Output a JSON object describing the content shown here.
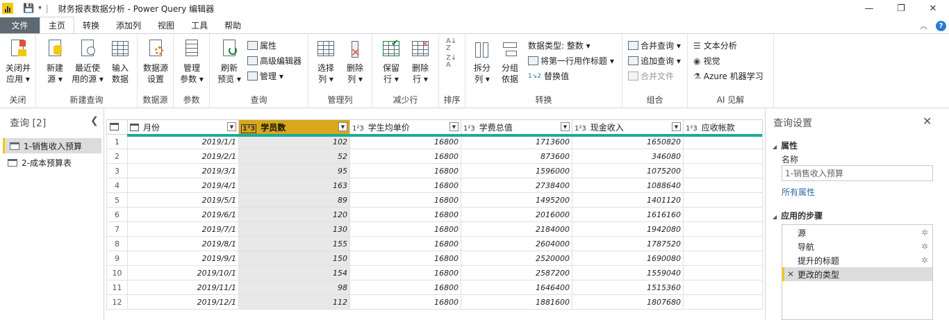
{
  "titlebar": {
    "title": "财务报表数据分析 - Power Query 编辑器"
  },
  "tabs": {
    "file": "文件",
    "items": [
      "主页",
      "转换",
      "添加列",
      "视图",
      "工具",
      "帮助"
    ],
    "active": "主页"
  },
  "ribbon": {
    "close": {
      "btn": "关闭并应用",
      "btn_l1": "关闭并",
      "btn_l2": "应用 ▾",
      "label": "关闭"
    },
    "newquery": {
      "new_l1": "新建",
      "new_l2": "源 ▾",
      "recent_l1": "最近使",
      "recent_l2": "用的源 ▾",
      "enter_l1": "输入",
      "enter_l2": "数据",
      "label": "新建查询"
    },
    "datasource": {
      "btn_l1": "数据源",
      "btn_l2": "设置",
      "label": "数据源"
    },
    "params": {
      "btn_l1": "管理",
      "btn_l2": "参数 ▾",
      "label": "参数"
    },
    "query": {
      "refresh_l1": "刷新",
      "refresh_l2": "预览 ▾",
      "properties": "属性",
      "advanced": "高级编辑器",
      "manage": "管理 ▾",
      "label": "查询"
    },
    "managecols": {
      "choose_l1": "选择",
      "choose_l2": "列 ▾",
      "remove_l1": "删除",
      "remove_l2": "列 ▾",
      "label": "管理列"
    },
    "reducerows": {
      "keep_l1": "保留",
      "keep_l2": "行 ▾",
      "remove_l1": "删除",
      "remove_l2": "行 ▾",
      "label": "减少行"
    },
    "sort": {
      "label": "排序"
    },
    "transform": {
      "split_l1": "拆分",
      "split_l2": "列 ▾",
      "group_l1": "分组",
      "group_l2": "依据",
      "datatype": "数据类型: 整数 ▾",
      "firstrow": "将第一行用作标题 ▾",
      "replace": "替换值",
      "label": "转换"
    },
    "combine": {
      "merge": "合并查询 ▾",
      "append": "追加查询 ▾",
      "files": "合并文件",
      "label": "组合"
    },
    "ai": {
      "text": "文本分析",
      "vision": "视觉",
      "azure": "Azure 机器学习",
      "label": "AI 见解"
    }
  },
  "queries": {
    "header": "查询 [2]",
    "items": [
      "1-销售收入预算",
      "2-成本预算表"
    ],
    "selected": 0
  },
  "grid": {
    "columns": [
      {
        "type": "date",
        "name": "月份"
      },
      {
        "type": "123",
        "name": "学员数",
        "selected": true
      },
      {
        "type": "123",
        "name": "学生均单价"
      },
      {
        "type": "123",
        "name": "学费总值"
      },
      {
        "type": "123",
        "name": "现金收入"
      },
      {
        "type": "123",
        "name": "应收帐款"
      }
    ],
    "rows": [
      [
        "1",
        "2019/1/1",
        "102",
        "16800",
        "1713600",
        "1650820"
      ],
      [
        "2",
        "2019/2/1",
        "52",
        "16800",
        "873600",
        "346080"
      ],
      [
        "3",
        "2019/3/1",
        "95",
        "16800",
        "1596000",
        "1075200"
      ],
      [
        "4",
        "2019/4/1",
        "163",
        "16800",
        "2738400",
        "1088640"
      ],
      [
        "5",
        "2019/5/1",
        "89",
        "16800",
        "1495200",
        "1401120"
      ],
      [
        "6",
        "2019/6/1",
        "120",
        "16800",
        "2016000",
        "1616160"
      ],
      [
        "7",
        "2019/7/1",
        "130",
        "16800",
        "2184000",
        "1942080"
      ],
      [
        "8",
        "2019/8/1",
        "155",
        "16800",
        "2604000",
        "1787520"
      ],
      [
        "9",
        "2019/9/1",
        "150",
        "16800",
        "2520000",
        "1690080"
      ],
      [
        "10",
        "2019/10/1",
        "154",
        "16800",
        "2587200",
        "1559040"
      ],
      [
        "11",
        "2019/11/1",
        "98",
        "16800",
        "1646400",
        "1515360"
      ],
      [
        "12",
        "2019/12/1",
        "112",
        "16800",
        "1881600",
        "1807680"
      ]
    ]
  },
  "settings": {
    "header": "查询设置",
    "props_title": "属性",
    "name_label": "名称",
    "name_value": "1-销售收入预算",
    "all_props": "所有属性",
    "steps_title": "应用的步骤",
    "steps": [
      "源",
      "导航",
      "提升的标题",
      "更改的类型"
    ]
  },
  "colors": {
    "file_tab": "#5e6a73",
    "accent": "#f2c811",
    "selected_col": "#d9a81a",
    "quality_bar": "#1aab9b",
    "link": "#2b6cb0"
  }
}
